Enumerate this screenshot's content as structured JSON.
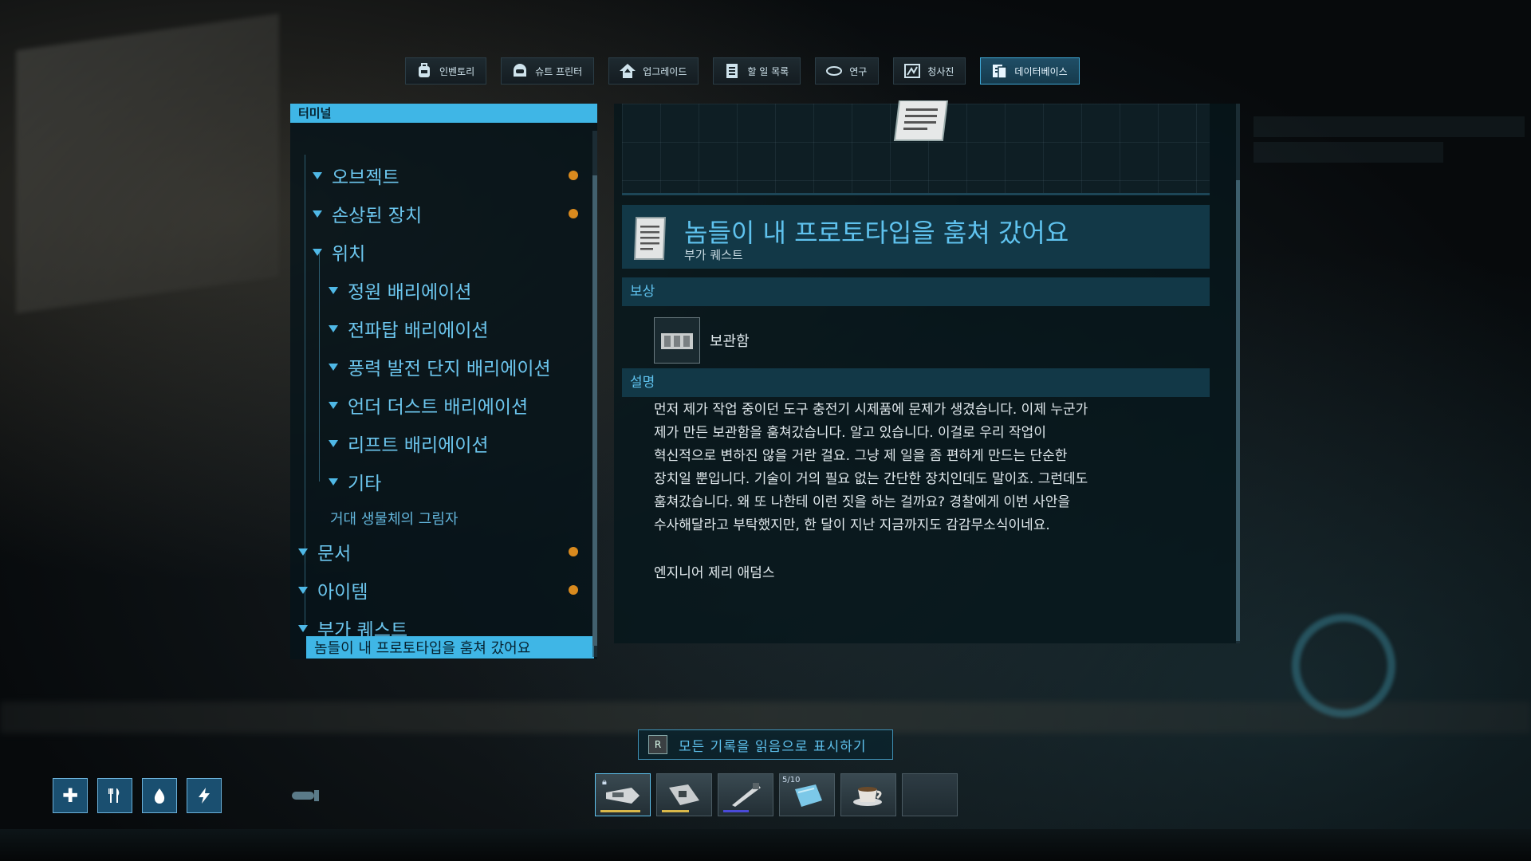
{
  "tabs": [
    {
      "label": "인벤토리",
      "icon": "backpack-icon"
    },
    {
      "label": "슈트 프린터",
      "icon": "helmet-icon"
    },
    {
      "label": "업그레이드",
      "icon": "upgrade-house-icon"
    },
    {
      "label": "할 일 목록",
      "icon": "checklist-icon"
    },
    {
      "label": "연구",
      "icon": "research-icon"
    },
    {
      "label": "청사진",
      "icon": "blueprint-icon"
    },
    {
      "label": "데이터베이스",
      "icon": "database-icon",
      "active": true
    }
  ],
  "terminal": {
    "header": "터미널",
    "tree": [
      {
        "label": "오브젝트",
        "unread": true
      },
      {
        "label": "손상된 장치",
        "unread": true
      },
      {
        "label": "위치"
      },
      {
        "label": "정원 배리에이션"
      },
      {
        "label": "전파탑 배리에이션"
      },
      {
        "label": "풍력 발전 단지 배리에이션"
      },
      {
        "label": "언더 더스트 배리에이션"
      },
      {
        "label": "리프트 배리에이션"
      },
      {
        "label": "기타"
      },
      {
        "label": "거대 생물체의 그림자"
      },
      {
        "label": "문서",
        "unread": true
      },
      {
        "label": "아이템",
        "unread": true
      },
      {
        "label": "부가 퀘스트"
      },
      {
        "label": "놈들이 내 프로토타입을 훔쳐 갔어요",
        "selected": true
      }
    ]
  },
  "entry": {
    "title": "놈들이 내 프로토타입을 훔쳐 갔어요",
    "category": "부가 퀘스트",
    "reward_header": "보상",
    "reward_item": "보관함",
    "description_header": "설명",
    "description_lines": [
      "먼저 제가 작업 중이던 도구 충전기 시제품에 문제가 생겼습니다. 이제 누군가",
      "제가 만든 보관함을 훔쳐갔습니다. 알고 있습니다. 이걸로 우리 작업이",
      "혁신적으로 변하진 않을 거란 걸요. 그냥 제 일을 좀 편하게 만드는 단순한",
      "장치일 뿐입니다. 기술이 거의 필요 없는 간단한 장치인데도 말이죠. 그런데도",
      "훔쳐갔습니다. 왜 또 나한테 이런 짓을 하는 걸까요? 경찰에게 이번 사안을",
      "수사해달라고 부탁했지만, 한 달이 지난 지금까지도 감감무소식이네요."
    ],
    "signature": "엔지니어 제리 애덤스"
  },
  "mark_all_read": {
    "key": "R",
    "label": "모든 기록을 읽음으로 표시하기"
  },
  "status_icons": [
    "health-icon",
    "food-icon",
    "water-icon",
    "energy-icon"
  ],
  "hotbar": [
    {
      "icon": "drill-tool-icon",
      "bar_color": "#d9b84a",
      "locked": true
    },
    {
      "icon": "scanner-tool-icon",
      "bar_color": "#d9b84a"
    },
    {
      "icon": "welder-tool-icon",
      "bar_color": "#4a4ad9"
    },
    {
      "icon": "ice-block-icon",
      "count": "5/10"
    },
    {
      "icon": "coffee-cup-icon"
    },
    {
      "icon": "empty-slot"
    }
  ],
  "colors": {
    "accent": "#3fb6e6",
    "unread_dot": "#d98a1e"
  }
}
